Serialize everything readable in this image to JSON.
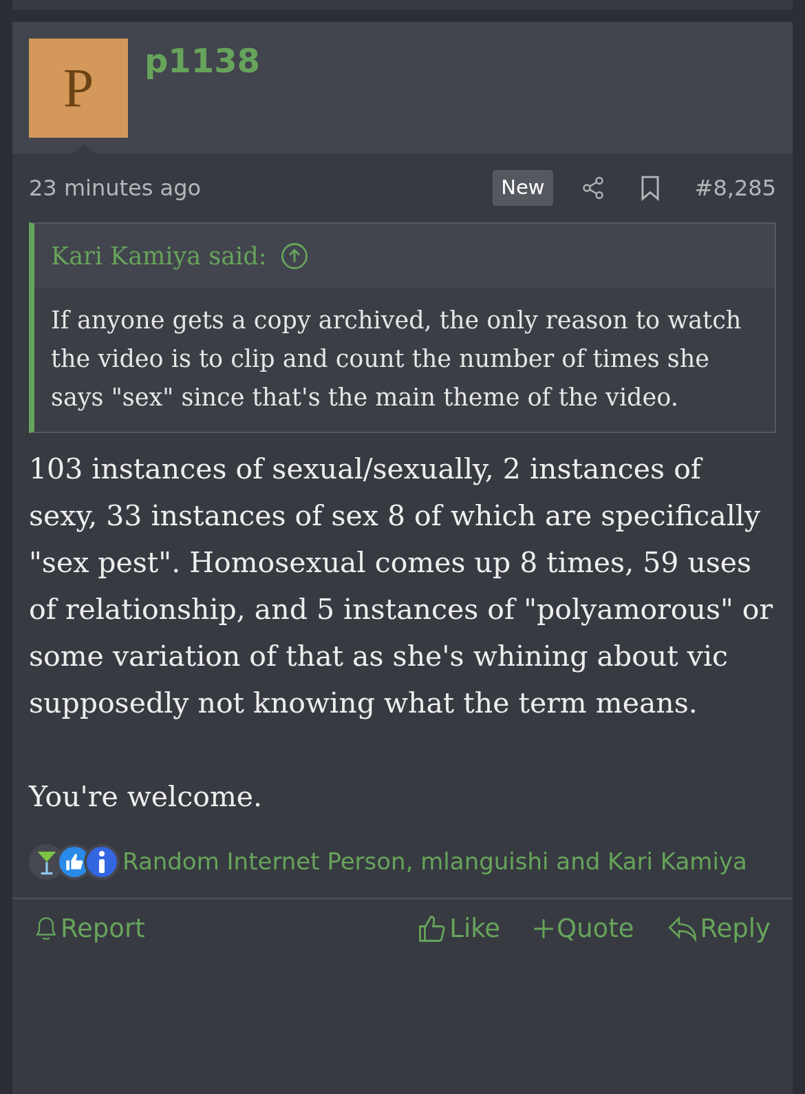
{
  "post": {
    "avatar_letter": "P",
    "username": "p1138",
    "time": "23 minutes ago",
    "badge": "New",
    "number": "#8,285",
    "quote": {
      "author": "Kari Kamiya said:",
      "text": "If anyone gets a copy archived, the only reason to watch the video is to clip and count the number of times she says \"sex\" since that's the main theme of the video."
    },
    "paragraphs": [
      "103 instances of sexual/sexually, 2 instances of sexy, 33 instances of sex 8 of which are specifically \"sex pest\". Homosexual comes up 8 times, 59 uses of relationship, and 5 instances of \"polyamorous\" or some variation of that as she's whining about vic supposedly not knowing what the term means.",
      "You're welcome."
    ],
    "reactions": "Random Internet Person, mlanguishi and Kari Kamiya",
    "actions": [
      {
        "kind": "report",
        "label": "Report"
      },
      {
        "kind": "like",
        "label": "Like"
      },
      {
        "kind": "quote",
        "label": "Quote"
      },
      {
        "kind": "reply",
        "label": "Reply"
      }
    ]
  }
}
